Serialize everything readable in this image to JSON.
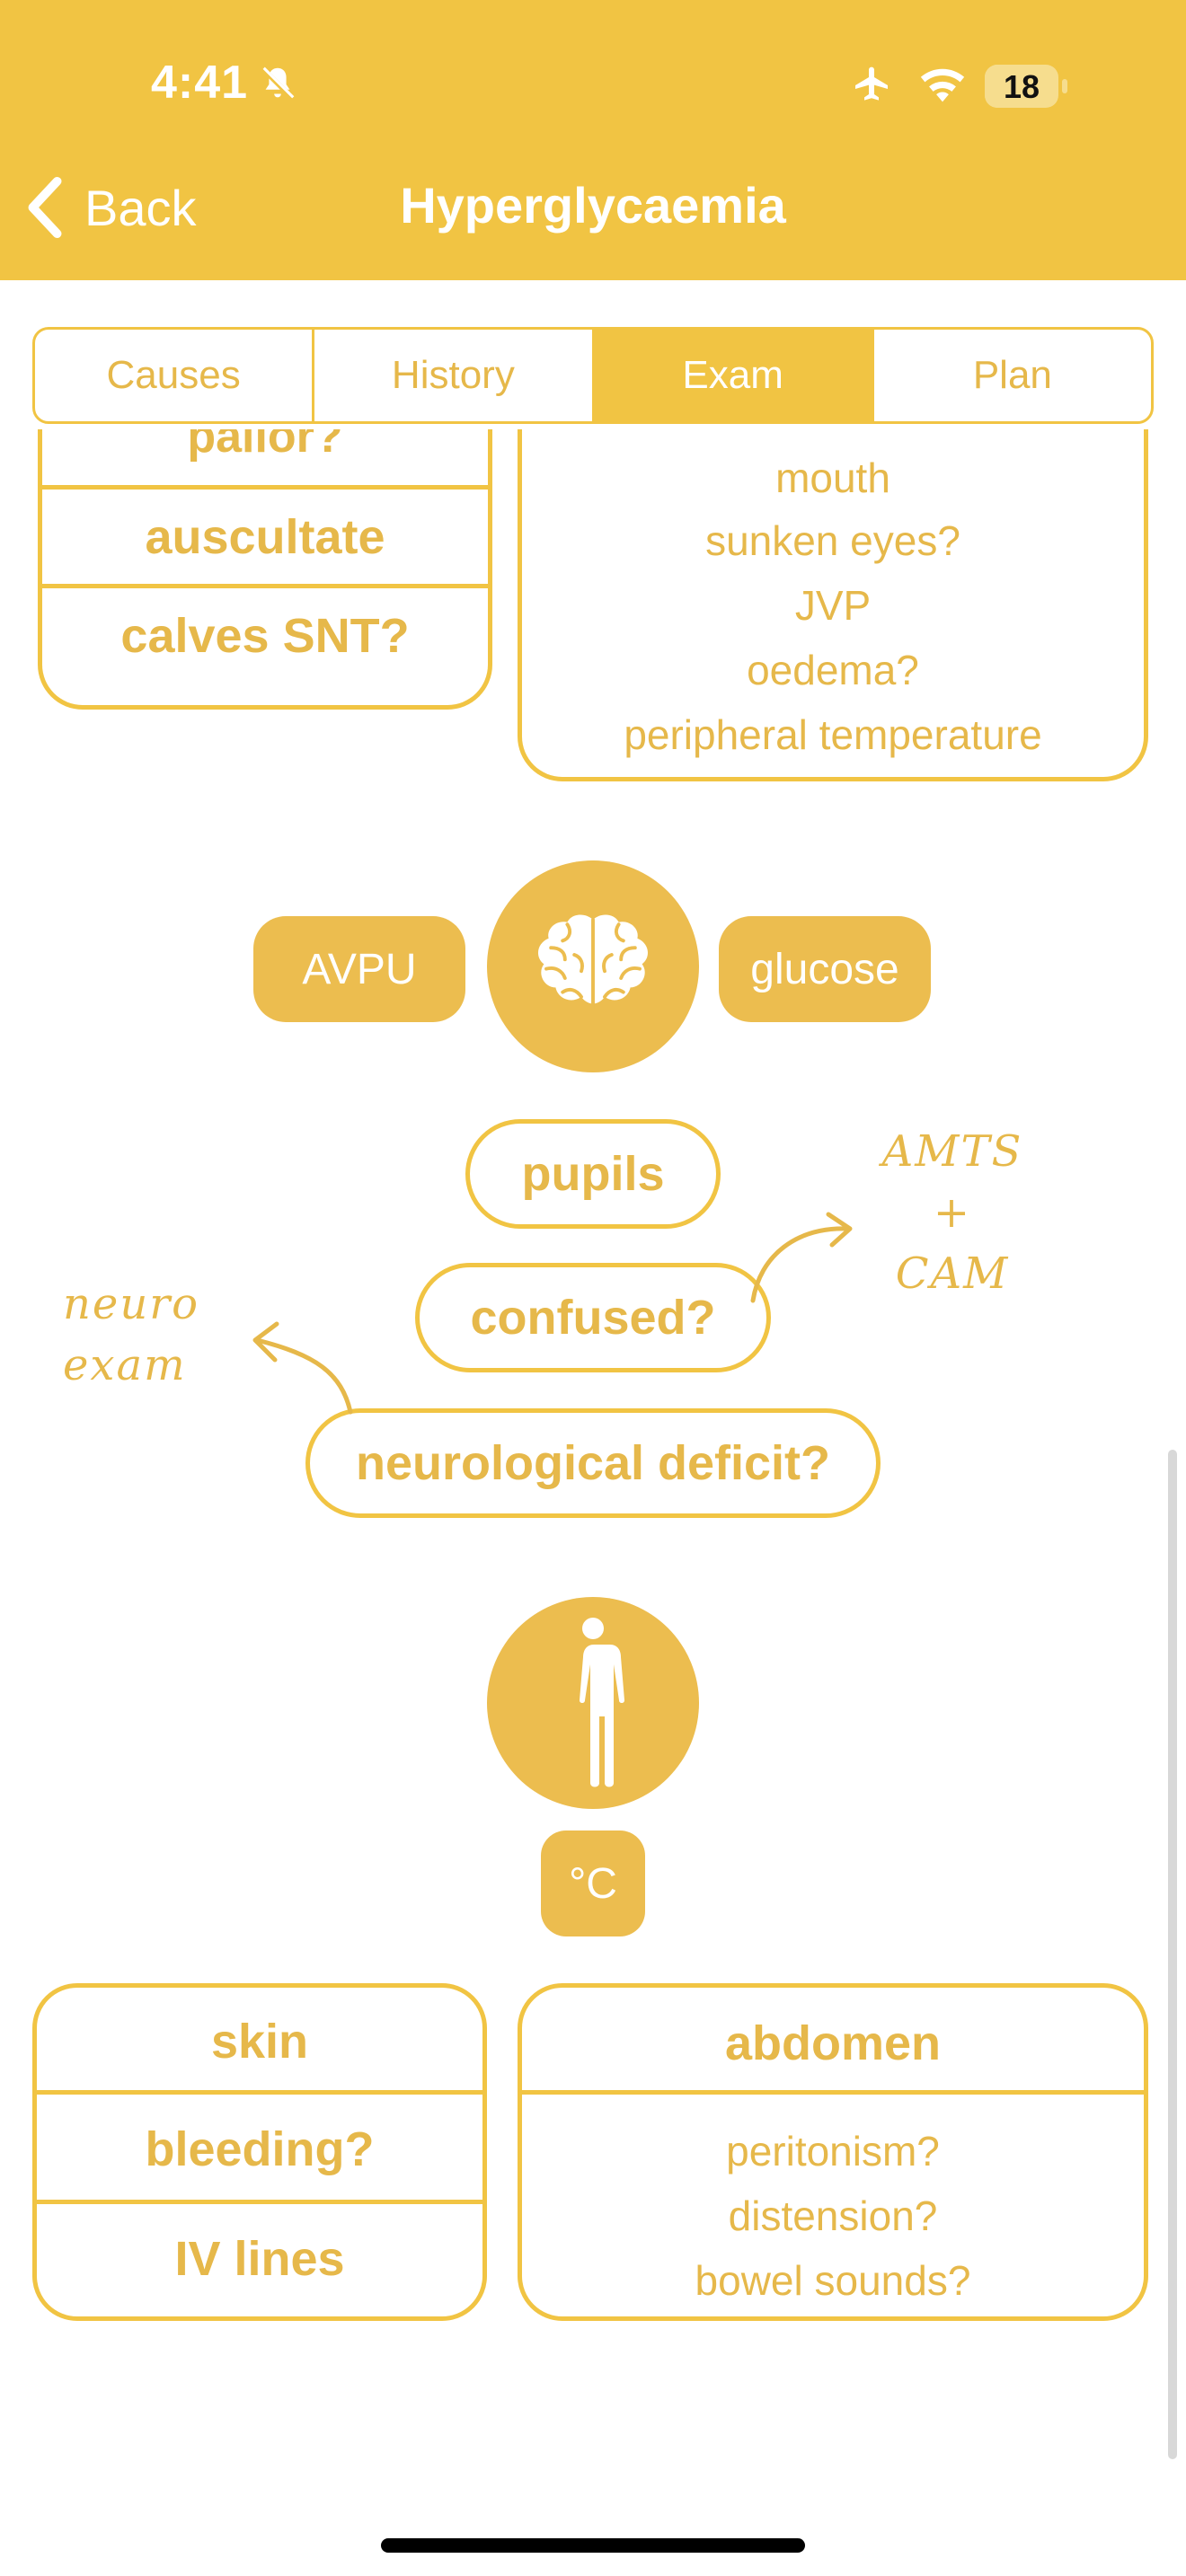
{
  "status_bar": {
    "time": "4:41",
    "battery_level": "18",
    "icons": [
      "bell-slash-icon",
      "airplane-icon",
      "wifi-icon",
      "battery-icon"
    ]
  },
  "nav": {
    "back_label": "Back",
    "title": "Hyperglycaemia"
  },
  "tabs": [
    {
      "label": "Causes",
      "active": false
    },
    {
      "label": "History",
      "active": false
    },
    {
      "label": "Exam",
      "active": true
    },
    {
      "label": "Plan",
      "active": false
    }
  ],
  "exam": {
    "left_top_box": {
      "items": [
        "pallor?",
        "auscultate",
        "calves SNT?"
      ]
    },
    "right_top_box": {
      "items": [
        "mouth",
        "sunken eyes?",
        "JVP",
        "oedema?",
        "peripheral temperature"
      ]
    },
    "neuro": {
      "icon": "brain-icon",
      "left_chip": "AVPU",
      "right_chip": "glucose",
      "pills": [
        "pupils",
        "confused?",
        "neurological deficit?"
      ],
      "note_right": [
        "AMTS",
        "+",
        "CAM"
      ],
      "note_left": [
        "neuro",
        "exam"
      ]
    },
    "body": {
      "icon": "human-body-icon",
      "temperature_chip": "°C"
    },
    "skin_box": {
      "items": [
        "skin",
        "bleeding?",
        "IV lines"
      ]
    },
    "abdomen_box": {
      "title": "abdomen",
      "items": [
        "peritonism?",
        "distension?",
        "bowel sounds?"
      ]
    }
  },
  "colors": {
    "accent": "#f1c443",
    "text_accent": "#e6b84a",
    "chip": "#ecbd4f"
  }
}
